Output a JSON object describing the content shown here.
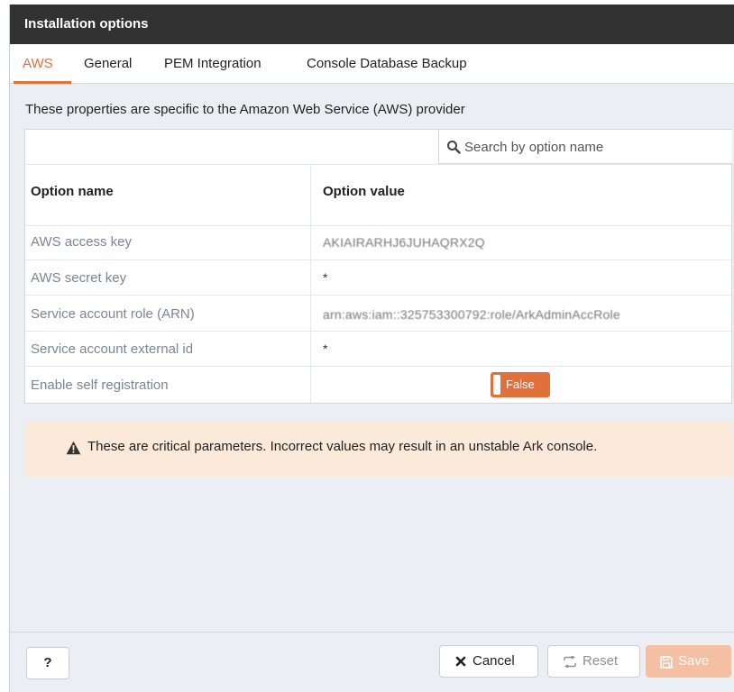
{
  "window": {
    "title": "Installation options"
  },
  "tabs": [
    {
      "label": "AWS",
      "active": true
    },
    {
      "label": "General",
      "active": false
    },
    {
      "label": "PEM Integration",
      "active": false
    },
    {
      "label": "Console Database Backup",
      "active": false
    }
  ],
  "description": "These properties are specific to the Amazon Web Service (AWS) provider",
  "search": {
    "placeholder": "Search by option name",
    "value": ""
  },
  "table": {
    "headers": {
      "name": "Option name",
      "value": "Option value"
    },
    "rows": [
      {
        "name": "AWS access key",
        "value": "AKIAIRARHJ6JUHAQRX2Q"
      },
      {
        "name": "AWS secret key",
        "value": "*"
      },
      {
        "name": "Service account role (ARN)",
        "value": "arn:aws:iam::325753300792:role/ArkAdminAccRole"
      },
      {
        "name": "Service account external id",
        "value": "*"
      },
      {
        "name": "Enable self registration",
        "toggle": "False"
      }
    ]
  },
  "alert": {
    "text": "These are critical parameters. Incorrect values may result in an unstable Ark console."
  },
  "footer": {
    "help_label": "?",
    "cancel_label": "Cancel",
    "reset_label": "Reset",
    "save_label": "Save"
  },
  "colors": {
    "accent": "#e2703a",
    "titlebar": "#323232",
    "alert_bg": "#fbead9",
    "save_disabled": "#f4bfa2"
  }
}
